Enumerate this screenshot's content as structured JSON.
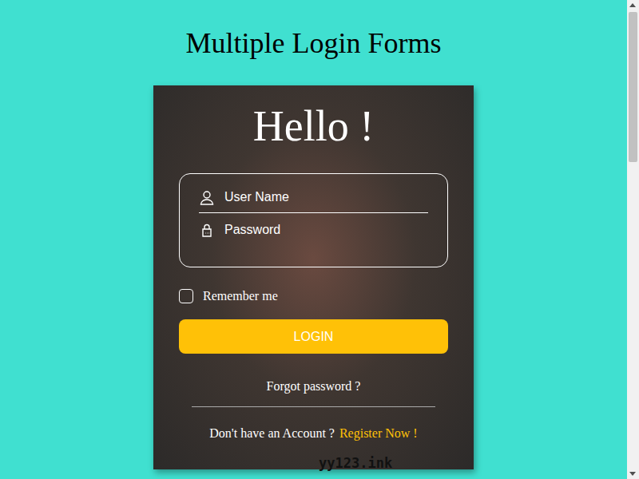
{
  "page": {
    "title": "Multiple Login Forms"
  },
  "card": {
    "heading": "Hello !",
    "fields": [
      {
        "placeholder": "User Name",
        "kind": "text"
      },
      {
        "placeholder": "Password",
        "kind": "password"
      }
    ],
    "remember": {
      "label": "Remember me",
      "checked": false
    },
    "login_button": "LOGIN",
    "forgot": "Forgot password ?",
    "signup_prompt": "Don't have an Account ?",
    "register_link": "Register Now !"
  },
  "watermark": "yy123.ink"
}
